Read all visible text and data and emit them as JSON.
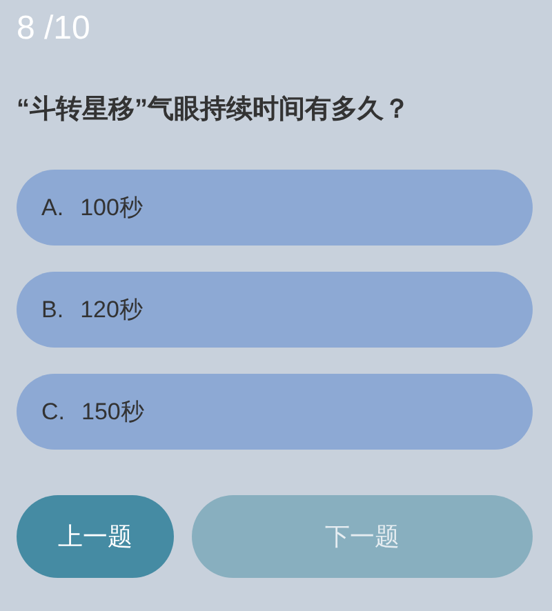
{
  "progress": "8 /10",
  "question": "“斗转星移”气眼持续时间有多久？",
  "options": [
    {
      "letter": "A.",
      "text": "100秒",
      "selected": false
    },
    {
      "letter": "B.",
      "text": "120秒",
      "selected": false
    },
    {
      "letter": "C.",
      "text": "150秒",
      "selected": false
    }
  ],
  "buttons": [
    {
      "label": "上一题",
      "disabled": false
    },
    {
      "label": "下一题",
      "disabled": true
    }
  ]
}
